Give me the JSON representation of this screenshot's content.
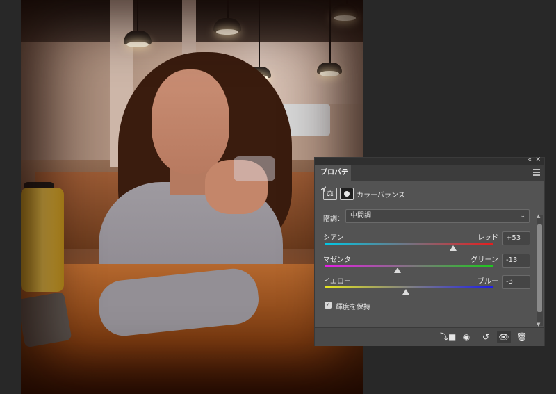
{
  "panel": {
    "tab_label": "プロパティ",
    "collapse_icon": "double-chevron-icon",
    "close_icon": "close-icon",
    "menu_icon": "panel-menu-icon",
    "adjustment_title": "カラーバランス",
    "adjustment_icon": "color-balance-icon",
    "mask_icon": "layer-mask-icon",
    "tone": {
      "label": "階調：",
      "selected": "中間調"
    },
    "sliders": [
      {
        "left_label": "シアン",
        "right_label": "レッド",
        "value": "+53",
        "level": 53,
        "gradient_from": "#00c8e6",
        "gradient_to": "#e61e1e"
      },
      {
        "left_label": "マゼンタ",
        "right_label": "グリーン",
        "value": "-13",
        "level": -13,
        "gradient_from": "#e61ee6",
        "gradient_to": "#1ec81e"
      },
      {
        "left_label": "イエロー",
        "right_label": "ブルー",
        "value": "-3",
        "level": -3,
        "gradient_from": "#e6e61e",
        "gradient_to": "#1e1ee6"
      }
    ],
    "preserve_luminosity": {
      "label": "輝度を保持",
      "checked": true
    },
    "bottom_toolbar": {
      "clip_icon": "clip-to-layer-icon",
      "view_previous_icon": "view-previous-state-icon",
      "reset_icon": "reset-icon",
      "visibility_icon": "visibility-eye-icon",
      "delete_icon": "trash-icon"
    }
  },
  "colors": {
    "panel_bg": "#535353",
    "field_bg": "#454545",
    "app_bg": "#2b2b2b"
  }
}
